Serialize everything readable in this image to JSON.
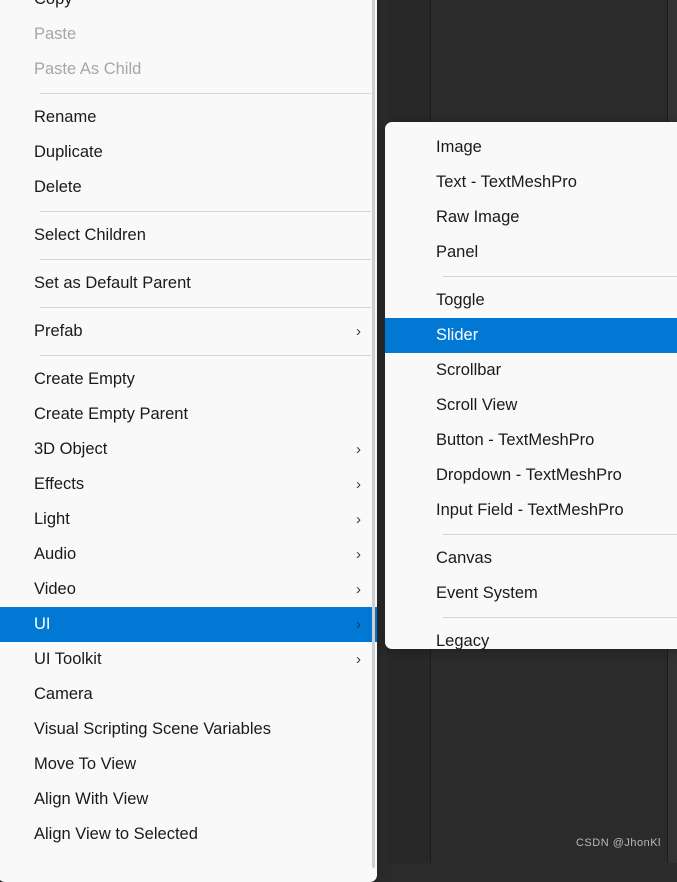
{
  "scene": {
    "watermark": "CSDN @JhonKl",
    "background_color": "#2b2b2b",
    "accent_color": "#0078d4",
    "menu_background_color": "#f9f9f9"
  },
  "primary_menu": {
    "chevron_glyph": "›",
    "entries": [
      {
        "type": "item",
        "label": "Copy",
        "state": "normal",
        "submenu": false
      },
      {
        "type": "item",
        "label": "Paste",
        "state": "disabled",
        "submenu": false
      },
      {
        "type": "item",
        "label": "Paste As Child",
        "state": "disabled",
        "submenu": false
      },
      {
        "type": "separator"
      },
      {
        "type": "item",
        "label": "Rename",
        "state": "normal",
        "submenu": false
      },
      {
        "type": "item",
        "label": "Duplicate",
        "state": "normal",
        "submenu": false
      },
      {
        "type": "item",
        "label": "Delete",
        "state": "normal",
        "submenu": false
      },
      {
        "type": "separator"
      },
      {
        "type": "item",
        "label": "Select Children",
        "state": "normal",
        "submenu": false
      },
      {
        "type": "separator"
      },
      {
        "type": "item",
        "label": "Set as Default Parent",
        "state": "normal",
        "submenu": false
      },
      {
        "type": "separator"
      },
      {
        "type": "item",
        "label": "Prefab",
        "state": "normal",
        "submenu": true
      },
      {
        "type": "separator"
      },
      {
        "type": "item",
        "label": "Create Empty",
        "state": "normal",
        "submenu": false
      },
      {
        "type": "item",
        "label": "Create Empty Parent",
        "state": "normal",
        "submenu": false
      },
      {
        "type": "item",
        "label": "3D Object",
        "state": "normal",
        "submenu": true
      },
      {
        "type": "item",
        "label": "Effects",
        "state": "normal",
        "submenu": true
      },
      {
        "type": "item",
        "label": "Light",
        "state": "normal",
        "submenu": true
      },
      {
        "type": "item",
        "label": "Audio",
        "state": "normal",
        "submenu": true
      },
      {
        "type": "item",
        "label": "Video",
        "state": "normal",
        "submenu": true
      },
      {
        "type": "item",
        "label": "UI",
        "state": "selected",
        "submenu": true
      },
      {
        "type": "item",
        "label": "UI Toolkit",
        "state": "normal",
        "submenu": true
      },
      {
        "type": "item",
        "label": "Camera",
        "state": "normal",
        "submenu": false
      },
      {
        "type": "item",
        "label": "Visual Scripting Scene Variables",
        "state": "normal",
        "submenu": false
      },
      {
        "type": "item",
        "label": "Move To View",
        "state": "normal",
        "submenu": false
      },
      {
        "type": "item",
        "label": "Align With View",
        "state": "normal",
        "submenu": false
      },
      {
        "type": "item",
        "label": "Align View to Selected",
        "state": "normal",
        "submenu": false
      }
    ]
  },
  "sub_menu": {
    "entries": [
      {
        "type": "item",
        "label": "Image",
        "state": "normal",
        "submenu": false
      },
      {
        "type": "item",
        "label": "Text - TextMeshPro",
        "state": "normal",
        "submenu": false
      },
      {
        "type": "item",
        "label": "Raw Image",
        "state": "normal",
        "submenu": false
      },
      {
        "type": "item",
        "label": "Panel",
        "state": "normal",
        "submenu": false
      },
      {
        "type": "separator"
      },
      {
        "type": "item",
        "label": "Toggle",
        "state": "normal",
        "submenu": false
      },
      {
        "type": "item",
        "label": "Slider",
        "state": "selected",
        "submenu": false
      },
      {
        "type": "item",
        "label": "Scrollbar",
        "state": "normal",
        "submenu": false
      },
      {
        "type": "item",
        "label": "Scroll View",
        "state": "normal",
        "submenu": false
      },
      {
        "type": "item",
        "label": "Button - TextMeshPro",
        "state": "normal",
        "submenu": false
      },
      {
        "type": "item",
        "label": "Dropdown - TextMeshPro",
        "state": "normal",
        "submenu": false
      },
      {
        "type": "item",
        "label": "Input Field - TextMeshPro",
        "state": "normal",
        "submenu": false
      },
      {
        "type": "separator"
      },
      {
        "type": "item",
        "label": "Canvas",
        "state": "normal",
        "submenu": false
      },
      {
        "type": "item",
        "label": "Event System",
        "state": "normal",
        "submenu": false
      },
      {
        "type": "separator"
      },
      {
        "type": "item",
        "label": "Legacy",
        "state": "normal",
        "submenu": false
      }
    ]
  }
}
